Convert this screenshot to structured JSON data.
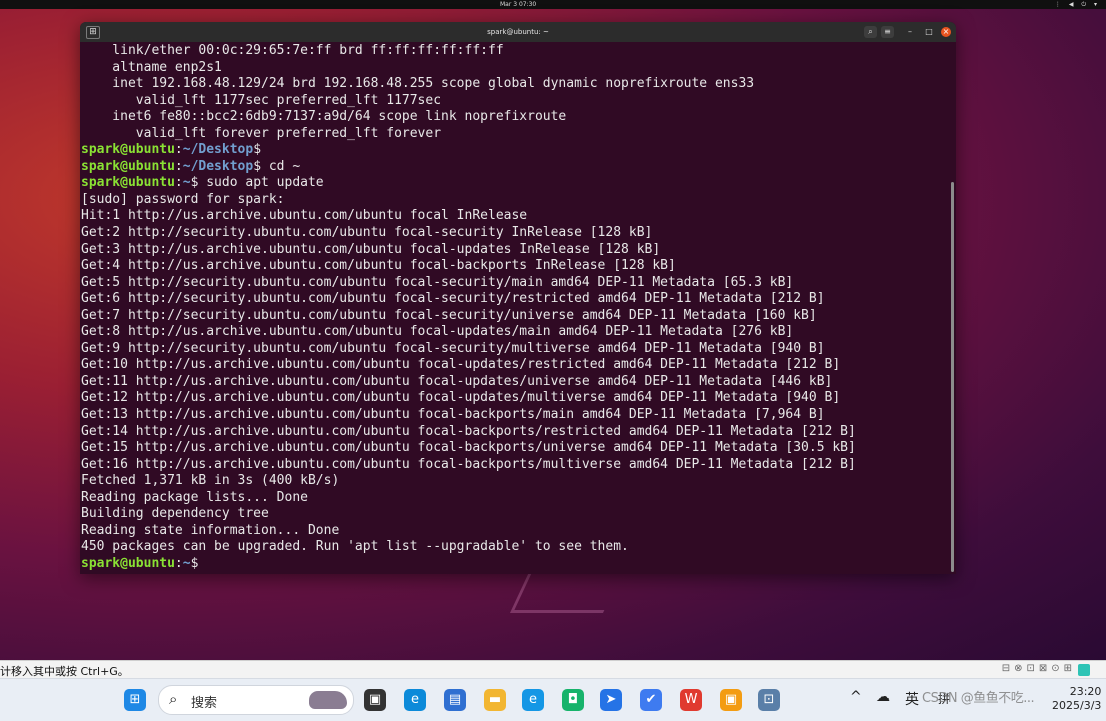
{
  "topbar": {
    "clock": "Mar 3  07:30",
    "tray_icons": "⋮ ◀ ⏻ ▾"
  },
  "window": {
    "title": "spark@ubuntu: ~",
    "newtab_glyph": "⊞",
    "search_glyph": "⌕",
    "menu_glyph": "≡",
    "minimize_glyph": "–",
    "maximize_glyph": "□",
    "close_glyph": "×"
  },
  "terminal": {
    "prompt_user": "spark@ubuntu",
    "lines": [
      {
        "k": "t",
        "text": "    link/ether 00:0c:29:65:7e:ff brd ff:ff:ff:ff:ff:ff"
      },
      {
        "k": "t",
        "text": "    altname enp2s1"
      },
      {
        "k": "t",
        "text": "    inet 192.168.48.129/24 brd 192.168.48.255 scope global dynamic noprefixroute ens33"
      },
      {
        "k": "t",
        "text": "       valid_lft 1177sec preferred_lft 1177sec"
      },
      {
        "k": "t",
        "text": "    inet6 fe80::bcc2:6db9:7137:a9d/64 scope link noprefixroute"
      },
      {
        "k": "t",
        "text": "       valid_lft forever preferred_lft forever"
      },
      {
        "k": "p",
        "path": "~/Desktop",
        "cmd": ""
      },
      {
        "k": "p",
        "path": "~/Desktop",
        "cmd": " cd ~"
      },
      {
        "k": "p",
        "path": "~",
        "cmd": " sudo apt update"
      },
      {
        "k": "t",
        "text": "[sudo] password for spark:"
      },
      {
        "k": "t",
        "text": "Hit:1 http://us.archive.ubuntu.com/ubuntu focal InRelease"
      },
      {
        "k": "t",
        "text": "Get:2 http://security.ubuntu.com/ubuntu focal-security InRelease [128 kB]"
      },
      {
        "k": "t",
        "text": "Get:3 http://us.archive.ubuntu.com/ubuntu focal-updates InRelease [128 kB]"
      },
      {
        "k": "t",
        "text": "Get:4 http://us.archive.ubuntu.com/ubuntu focal-backports InRelease [128 kB]"
      },
      {
        "k": "t",
        "text": "Get:5 http://security.ubuntu.com/ubuntu focal-security/main amd64 DEP-11 Metadata [65.3 kB]"
      },
      {
        "k": "t",
        "text": "Get:6 http://security.ubuntu.com/ubuntu focal-security/restricted amd64 DEP-11 Metadata [212 B]"
      },
      {
        "k": "t",
        "text": "Get:7 http://security.ubuntu.com/ubuntu focal-security/universe amd64 DEP-11 Metadata [160 kB]"
      },
      {
        "k": "t",
        "text": "Get:8 http://us.archive.ubuntu.com/ubuntu focal-updates/main amd64 DEP-11 Metadata [276 kB]"
      },
      {
        "k": "t",
        "text": "Get:9 http://security.ubuntu.com/ubuntu focal-security/multiverse amd64 DEP-11 Metadata [940 B]"
      },
      {
        "k": "t",
        "text": "Get:10 http://us.archive.ubuntu.com/ubuntu focal-updates/restricted amd64 DEP-11 Metadata [212 B]"
      },
      {
        "k": "t",
        "text": "Get:11 http://us.archive.ubuntu.com/ubuntu focal-updates/universe amd64 DEP-11 Metadata [446 kB]"
      },
      {
        "k": "t",
        "text": "Get:12 http://us.archive.ubuntu.com/ubuntu focal-updates/multiverse amd64 DEP-11 Metadata [940 B]"
      },
      {
        "k": "t",
        "text": "Get:13 http://us.archive.ubuntu.com/ubuntu focal-backports/main amd64 DEP-11 Metadata [7,964 B]"
      },
      {
        "k": "t",
        "text": "Get:14 http://us.archive.ubuntu.com/ubuntu focal-backports/restricted amd64 DEP-11 Metadata [212 B]"
      },
      {
        "k": "t",
        "text": "Get:15 http://us.archive.ubuntu.com/ubuntu focal-backports/universe amd64 DEP-11 Metadata [30.5 kB]"
      },
      {
        "k": "t",
        "text": "Get:16 http://us.archive.ubuntu.com/ubuntu focal-backports/multiverse amd64 DEP-11 Metadata [212 B]"
      },
      {
        "k": "t",
        "text": "Fetched 1,371 kB in 3s (400 kB/s)"
      },
      {
        "k": "t",
        "text": "Reading package lists... Done"
      },
      {
        "k": "t",
        "text": "Building dependency tree"
      },
      {
        "k": "t",
        "text": "Reading state information... Done"
      },
      {
        "k": "t",
        "text": "450 packages can be upgraded. Run 'apt list --upgradable' to see them."
      },
      {
        "k": "p",
        "path": "~",
        "cmd": " "
      }
    ]
  },
  "statusbar": {
    "hint": "计移入其中或按 Ctrl+G。",
    "icons": "⊟⊗⊡⊠⊙⊞"
  },
  "taskbar": {
    "search_placeholder": "搜索",
    "search_glyph": "⌕",
    "apps": [
      {
        "name": "windows-start",
        "glyph": "⊞",
        "color": "#1e88e5"
      },
      {
        "name": "task-view",
        "glyph": "▣",
        "color": "#333333"
      },
      {
        "name": "edge",
        "glyph": "e",
        "color": "#0c8ad9"
      },
      {
        "name": "store",
        "glyph": "▤",
        "color": "#2f6fd1"
      },
      {
        "name": "file-explorer",
        "glyph": "▬",
        "color": "#f2b632"
      },
      {
        "name": "edge-dev",
        "glyph": "e",
        "color": "#1597e5"
      },
      {
        "name": "wechat-work",
        "glyph": "◘",
        "color": "#17b36b"
      },
      {
        "name": "feishu",
        "glyph": "➤",
        "color": "#2573e6"
      },
      {
        "name": "lark",
        "glyph": "✔",
        "color": "#3e7bf0"
      },
      {
        "name": "wps",
        "glyph": "W",
        "color": "#e03a2f"
      },
      {
        "name": "vmware",
        "glyph": "▣",
        "color": "#f39c12"
      },
      {
        "name": "network-app",
        "glyph": "⊡",
        "color": "#5a7fa8"
      }
    ],
    "tray_caret": "^",
    "tray_cloud": "☁",
    "ime": "英",
    "layout_glyph": "拼",
    "watermark": "CSDN @鱼鱼不吃...",
    "time": "23:20",
    "date": "2025/3/3"
  }
}
